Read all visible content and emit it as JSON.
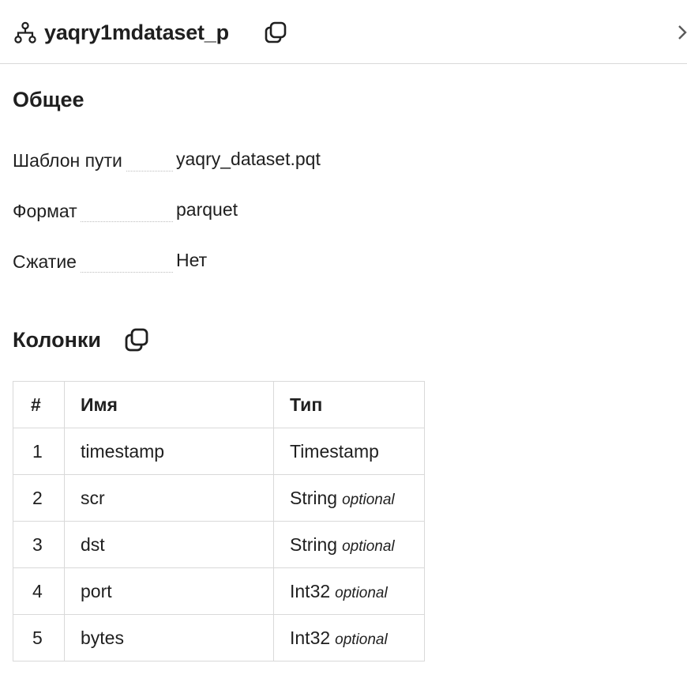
{
  "header": {
    "title": "yaqry1mdataset_p",
    "icons": {
      "object": "schema-tree-icon",
      "copy": "copy-icon",
      "close": "chevron-right-icon"
    }
  },
  "general": {
    "title": "Общее",
    "rows": [
      {
        "label": "Шаблон пути",
        "value": "yaqry_dataset.pqt"
      },
      {
        "label": "Формат",
        "value": "parquet"
      },
      {
        "label": "Сжатие",
        "value": "Нет"
      }
    ]
  },
  "columns": {
    "title": "Колонки",
    "headers": {
      "num": "#",
      "name": "Имя",
      "type": "Тип"
    },
    "rows": [
      {
        "num": "1",
        "name": "timestamp",
        "type": "Timestamp",
        "optional": ""
      },
      {
        "num": "2",
        "name": "scr",
        "type": "String",
        "optional": "optional"
      },
      {
        "num": "3",
        "name": "dst",
        "type": "String",
        "optional": "optional"
      },
      {
        "num": "4",
        "name": "port",
        "type": "Int32",
        "optional": "optional"
      },
      {
        "num": "5",
        "name": "bytes",
        "type": "Int32",
        "optional": "optional"
      }
    ]
  }
}
